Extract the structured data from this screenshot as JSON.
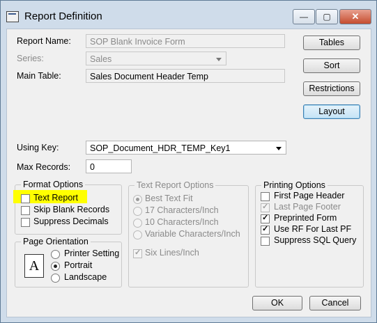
{
  "window": {
    "title": "Report Definition",
    "minimize": "—",
    "maximize": "▢",
    "close": "✕"
  },
  "fields": {
    "report_name_label": "Report Name:",
    "report_name_value": "SOP Blank Invoice Form",
    "series_label": "Series:",
    "series_value": "Sales",
    "main_table_label": "Main Table:",
    "main_table_value": "Sales Document Header Temp",
    "using_key_label": "Using Key:",
    "using_key_value": "SOP_Document_HDR_TEMP_Key1",
    "max_records_label": "Max Records:",
    "max_records_value": "0"
  },
  "side_buttons": {
    "tables": "Tables",
    "sort": "Sort",
    "restrictions": "Restrictions",
    "layout": "Layout"
  },
  "format_options": {
    "legend": "Format Options",
    "items": [
      {
        "label": "Text Report",
        "checked": false,
        "highlighted": true
      },
      {
        "label": "Skip Blank Records",
        "checked": false
      },
      {
        "label": "Suppress Decimals",
        "checked": false
      }
    ]
  },
  "page_orientation": {
    "legend": "Page Orientation",
    "icon_letter": "A",
    "items": [
      {
        "label": "Printer Setting",
        "selected": false
      },
      {
        "label": "Portrait",
        "selected": true
      },
      {
        "label": "Landscape",
        "selected": false
      }
    ]
  },
  "text_report_options": {
    "legend": "Text Report Options",
    "items": [
      {
        "label": "Best Text Fit",
        "selected": true
      },
      {
        "label": "17 Characters/Inch",
        "selected": false
      },
      {
        "label": "10 Characters/Inch",
        "selected": false
      },
      {
        "label": "Variable Characters/Inch",
        "selected": false
      }
    ],
    "six_lines": {
      "label": "Six Lines/Inch",
      "checked": true
    }
  },
  "printing_options": {
    "legend": "Printing Options",
    "items": [
      {
        "label": "First Page Header",
        "checked": false,
        "disabled": false
      },
      {
        "label": "Last Page Footer",
        "checked": true,
        "disabled": true
      },
      {
        "label": "Preprinted Form",
        "checked": true,
        "disabled": false
      },
      {
        "label": "Use RF For Last PF",
        "checked": true,
        "disabled": false
      },
      {
        "label": "Suppress SQL Query",
        "checked": false,
        "disabled": false
      }
    ]
  },
  "footer": {
    "ok": "OK",
    "cancel": "Cancel"
  },
  "colors": {
    "title_bar": "#cfdcea",
    "highlight": "#ffff00",
    "focus_button": "#c4e3f6"
  },
  "icons": [
    "app-icon",
    "minimize-icon",
    "maximize-icon",
    "close-icon",
    "dropdown-arrow-icon",
    "checkmark-icon",
    "page-letter-a-icon"
  ]
}
